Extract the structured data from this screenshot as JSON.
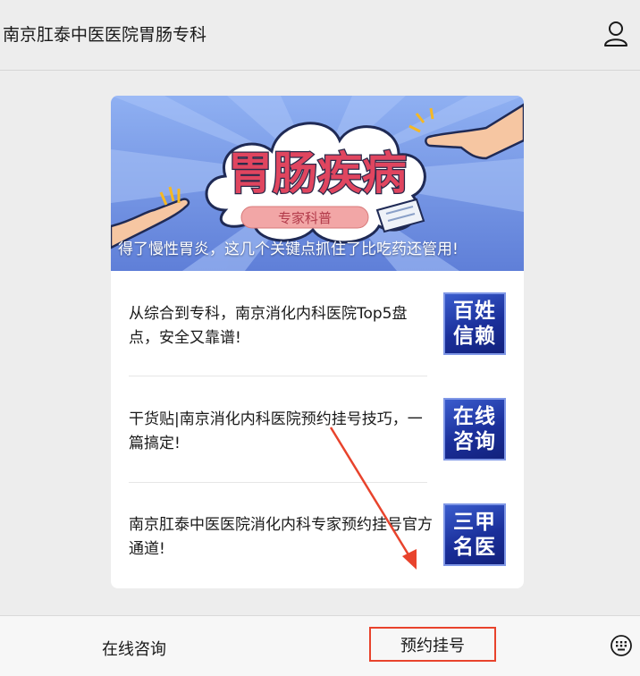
{
  "header": {
    "title": "南京肛泰中医医院胃肠专科"
  },
  "banner": {
    "headline": "胃肠疾病",
    "tag": "专家科普",
    "caption": "得了慢性胃炎，这几个关键点抓住了比吃药还管用!",
    "colors": {
      "sky": "#7a9ae8",
      "title": "#e0455f",
      "tag": "#f2a6a6"
    }
  },
  "articles": [
    {
      "title": "从综合到专科，南京消化内科医院Top5盘点，安全又靠谱!",
      "thumb_lines": [
        "百姓",
        "信赖"
      ]
    },
    {
      "title": "干货贴|南京消化内科医院预约挂号技巧，一篇搞定!",
      "thumb_lines": [
        "在线",
        "咨询"
      ]
    },
    {
      "title": "南京肛泰中医医院消化内科专家预约挂号官方通道!",
      "thumb_lines": [
        "三甲",
        "名医"
      ]
    }
  ],
  "bottom_menu": {
    "consult": "在线咨询",
    "book": "预约挂号",
    "highlight_color": "#e8432c"
  },
  "icons": {
    "user": "user-icon",
    "keyboard": "keyboard-icon"
  }
}
